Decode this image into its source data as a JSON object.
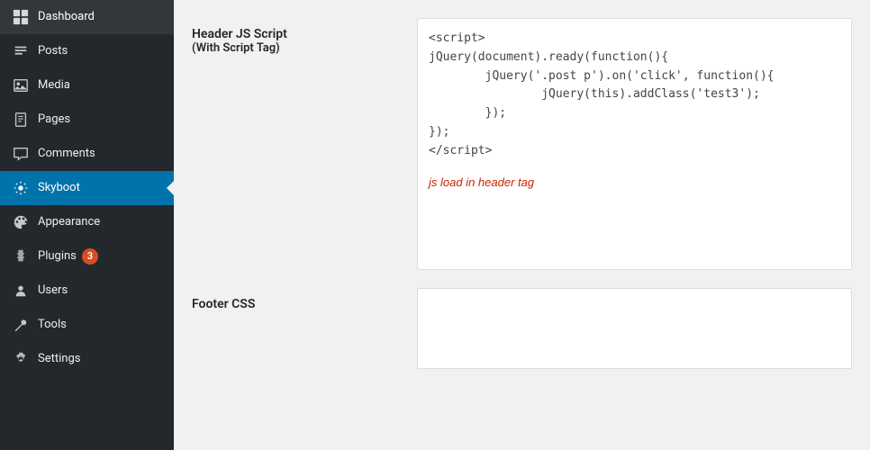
{
  "sidebar": {
    "items": [
      {
        "id": "dashboard",
        "label": "Dashboard",
        "icon": "⊞",
        "active": false
      },
      {
        "id": "posts",
        "label": "Posts",
        "icon": "✎",
        "active": false
      },
      {
        "id": "media",
        "label": "Media",
        "icon": "⬚",
        "active": false
      },
      {
        "id": "pages",
        "label": "Pages",
        "icon": "☰",
        "active": false
      },
      {
        "id": "comments",
        "label": "Comments",
        "icon": "💬",
        "active": false
      },
      {
        "id": "skyboot",
        "label": "Skyboot",
        "icon": "⚙",
        "active": true
      },
      {
        "id": "appearance",
        "label": "Appearance",
        "icon": "🎨",
        "active": false
      },
      {
        "id": "plugins",
        "label": "Plugins",
        "icon": "🔌",
        "active": false,
        "badge": "3"
      },
      {
        "id": "users",
        "label": "Users",
        "icon": "👤",
        "active": false
      },
      {
        "id": "tools",
        "label": "Tools",
        "icon": "🔧",
        "active": false
      },
      {
        "id": "settings",
        "label": "Settings",
        "icon": "⚙",
        "active": false
      }
    ]
  },
  "main": {
    "header_js_section": {
      "label_line1": "Header JS Script",
      "label_line2": "(With Script Tag)",
      "code": "<script>\njQuery(document).ready(function(){\n        jQuery('.post p').on('click', function(){\n                jQuery(this).addClass('test3');\n        });\n});\n</script>",
      "note": "js load in header tag"
    },
    "footer_css_section": {
      "label": "Footer CSS"
    }
  }
}
